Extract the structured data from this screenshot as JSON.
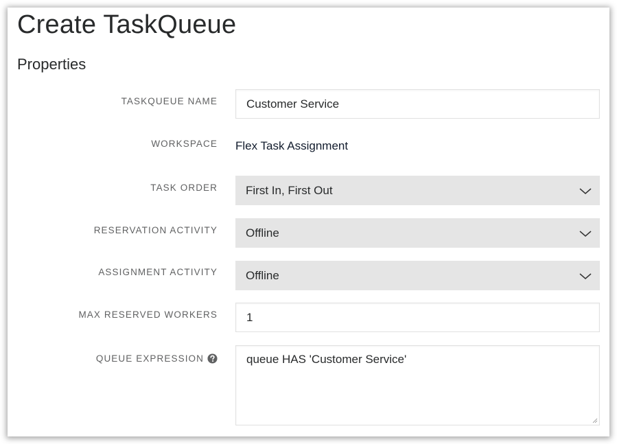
{
  "page": {
    "title": "Create TaskQueue",
    "section_title": "Properties"
  },
  "form": {
    "taskqueue_name": {
      "label": "TASKQUEUE NAME",
      "value": "Customer Service"
    },
    "workspace": {
      "label": "WORKSPACE",
      "value": "Flex Task Assignment"
    },
    "task_order": {
      "label": "TASK ORDER",
      "selected": "First In, First Out",
      "icon": "chevron-down-icon"
    },
    "reservation_activity": {
      "label": "RESERVATION ACTIVITY",
      "selected": "Offline",
      "icon": "chevron-down-icon"
    },
    "assignment_activity": {
      "label": "ASSIGNMENT ACTIVITY",
      "selected": "Offline",
      "icon": "chevron-down-icon"
    },
    "max_reserved_workers": {
      "label": "MAX RESERVED WORKERS",
      "value": "1"
    },
    "queue_expression": {
      "label": "QUEUE EXPRESSION",
      "help_icon": "question-circle-icon",
      "value": "queue HAS 'Customer Service'"
    }
  },
  "colors": {
    "select_background": "#e5e5e5",
    "input_border": "#e1e1e1",
    "label_text": "#606162",
    "body_text": "#282a2b"
  }
}
